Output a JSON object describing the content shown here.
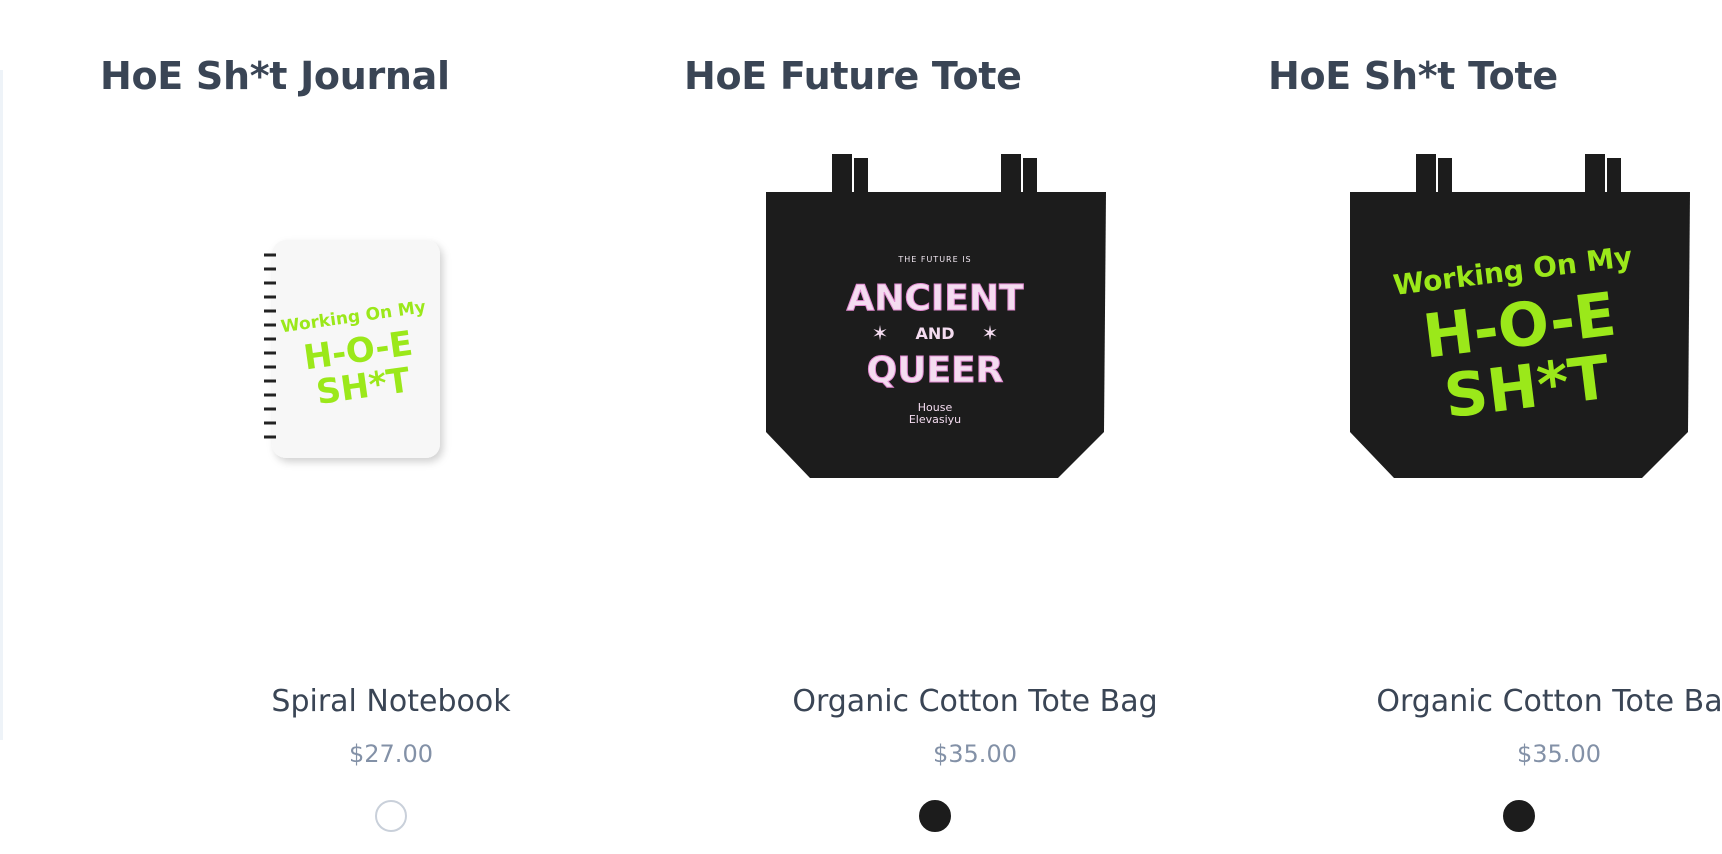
{
  "products": [
    {
      "title": "HoE Sh*t Journal",
      "type": "Spiral Notebook",
      "price": "$27.00",
      "swatch_color": "#ffffff",
      "artwork": [
        "Working On My",
        "H-O-E",
        "SH*T"
      ]
    },
    {
      "title": "HoE Future Tote",
      "type": "Organic Cotton Tote Bag",
      "price": "$35.00",
      "swatch_color": "#1c1c1c",
      "artwork": [
        "THE FUTURE IS",
        "ANCIENT",
        "AND",
        "QUEER",
        "House",
        "Elevasiyu"
      ]
    },
    {
      "title": "HoE Sh*t Tote",
      "type": "Organic Cotton Tote Bag",
      "price": "$35.00",
      "swatch_color": "#1c1c1c",
      "artwork": [
        "Working On My",
        "H-O-E",
        "SH*T"
      ]
    }
  ],
  "colors": {
    "title": "#3a4555",
    "price": "#8391a7",
    "lime": "#9be81a",
    "tote": "#1c1c1c"
  }
}
